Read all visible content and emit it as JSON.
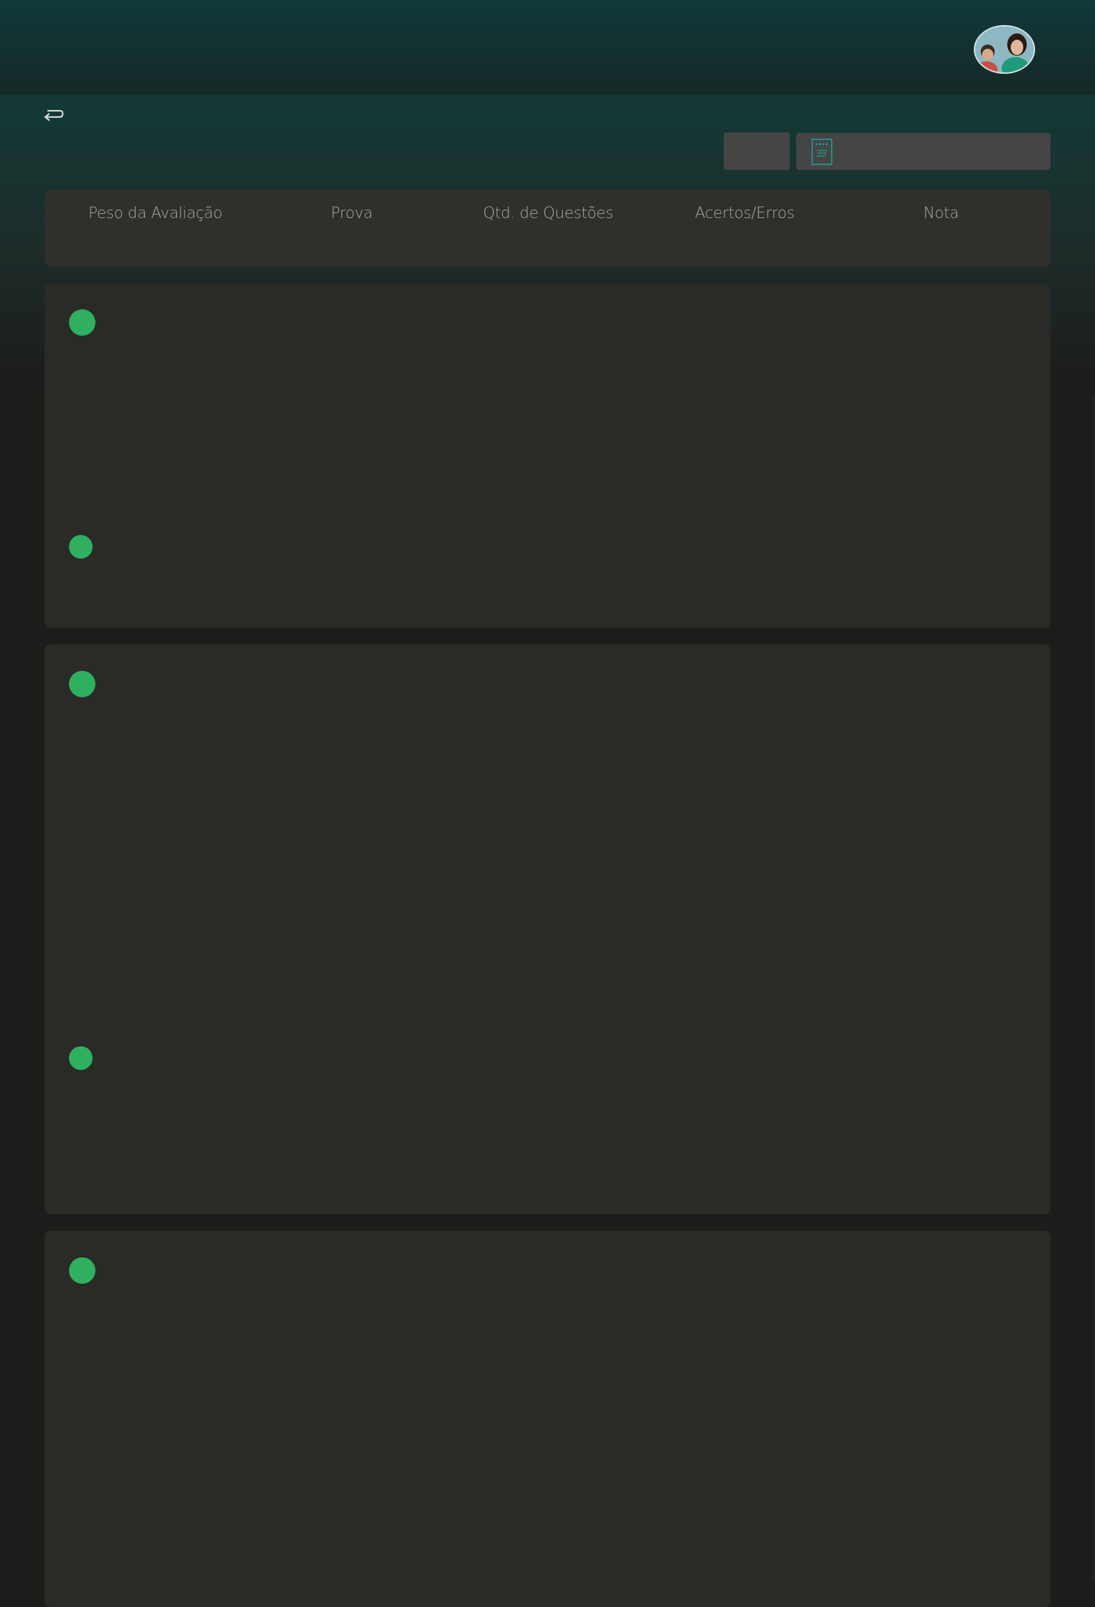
{
  "header": {
    "avatar_alt": "user avatar"
  },
  "toolbar": {
    "small_button_label": "",
    "select_value": ""
  },
  "table": {
    "columns": [
      "Peso da Avaliação",
      "Prova",
      "Qtd. de Questões",
      "Acertos/Erros",
      "Nota"
    ]
  },
  "colors": {
    "accent_green": "#2fb060",
    "teal": "#1aa7a0",
    "card_bg": "#2a2a27"
  }
}
